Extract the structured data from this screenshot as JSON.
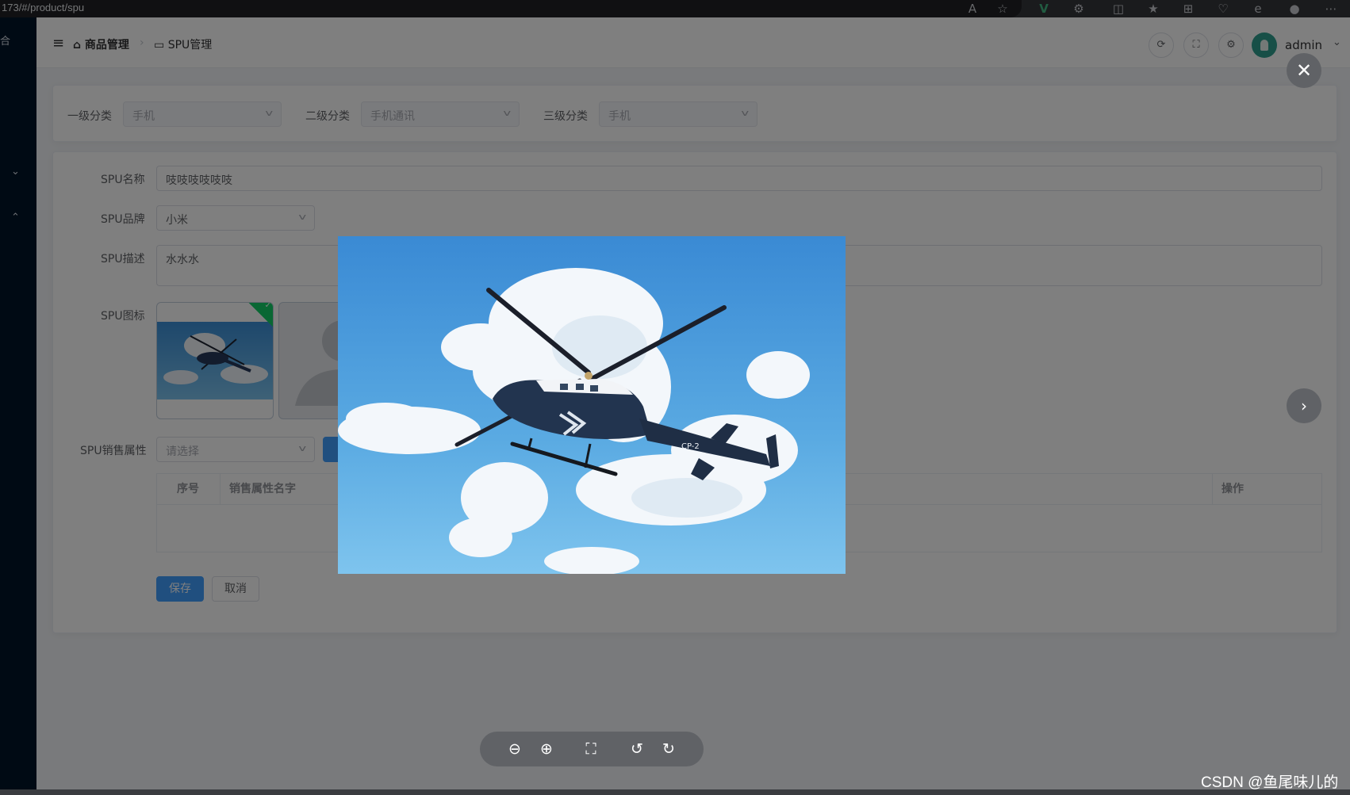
{
  "browser": {
    "url": "173/#/product/spu",
    "icons": [
      "read-aloud-icon",
      "favorite-star-icon",
      "vue-devtools-icon",
      "extensions-icon",
      "split-screen-icon",
      "favorites-icon",
      "collections-icon",
      "performance-icon",
      "edge-icon",
      "profile-icon",
      "more-icon"
    ]
  },
  "sidebar": {
    "glyph_top": "合"
  },
  "header": {
    "breadcrumb": [
      "商品管理",
      "SPU管理"
    ],
    "username": "admin"
  },
  "category": {
    "level1_label": "一级分类",
    "level1_value": "手机",
    "level2_label": "二级分类",
    "level2_value": "手机通讯",
    "level3_label": "三级分类",
    "level3_value": "手机"
  },
  "form": {
    "name_label": "SPU名称",
    "name_value": "吱吱吱吱吱吱",
    "brand_label": "SPU品牌",
    "brand_value": "小米",
    "desc_label": "SPU描述",
    "desc_value": "水水水",
    "image_label": "SPU图标",
    "sale_attr_label": "SPU销售属性",
    "sale_attr_placeholder": "请选择",
    "table_headers": [
      "序号",
      "销售属性名字",
      "操作"
    ],
    "save_label": "保存",
    "cancel_label": "取消"
  },
  "viewer": {
    "toolbar_icons": [
      "zoom-out-icon",
      "zoom-in-icon",
      "fullscreen-icon",
      "rotate-left-icon",
      "rotate-right-icon"
    ]
  },
  "watermark": "CSDN @鱼尾味儿的",
  "colors": {
    "primary": "#409eff",
    "sidebar_bg": "#001529",
    "success_badge": "#13ce66"
  }
}
